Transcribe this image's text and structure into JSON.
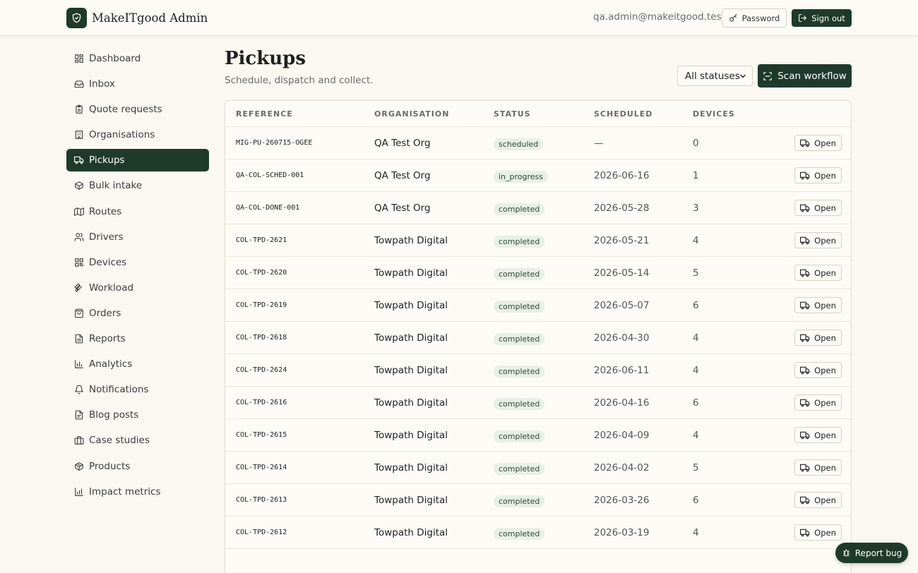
{
  "header": {
    "brand": "MakeITgood Admin",
    "user_email": "qa.admin@makeitgood.test",
    "password_label": "Password",
    "signout_label": "Sign out"
  },
  "sidebar": {
    "items": [
      {
        "label": "Dashboard",
        "icon": "dashboard-icon"
      },
      {
        "label": "Inbox",
        "icon": "inbox-icon"
      },
      {
        "label": "Quote requests",
        "icon": "clipboard-icon"
      },
      {
        "label": "Organisations",
        "icon": "building-icon"
      },
      {
        "label": "Pickups",
        "icon": "truck-icon",
        "active": true
      },
      {
        "label": "Bulk intake",
        "icon": "package-icon"
      },
      {
        "label": "Routes",
        "icon": "map-icon"
      },
      {
        "label": "Drivers",
        "icon": "users-icon"
      },
      {
        "label": "Devices",
        "icon": "qr-icon"
      },
      {
        "label": "Workload",
        "icon": "wrench-icon"
      },
      {
        "label": "Orders",
        "icon": "shopping-bag-icon"
      },
      {
        "label": "Reports",
        "icon": "file-icon"
      },
      {
        "label": "Analytics",
        "icon": "bar-chart-icon"
      },
      {
        "label": "Notifications",
        "icon": "bell-icon"
      },
      {
        "label": "Blog posts",
        "icon": "document-icon"
      },
      {
        "label": "Case studies",
        "icon": "briefcase-icon"
      },
      {
        "label": "Products",
        "icon": "box-icon"
      },
      {
        "label": "Impact metrics",
        "icon": "chart-icon"
      }
    ]
  },
  "main": {
    "title": "Pickups",
    "subtitle": "Schedule, dispatch and collect.",
    "status_filter": "All statuses",
    "scan_label": "Scan workflow",
    "columns": [
      "REFERENCE",
      "ORGANISATION",
      "STATUS",
      "SCHEDULED",
      "DEVICES"
    ],
    "open_label": "Open",
    "rows": [
      {
        "ref": "MIG-PU-260715-OGEE",
        "org": "QA Test Org",
        "status": "scheduled",
        "scheduled": "—",
        "devices": "0"
      },
      {
        "ref": "QA-COL-SCHED-001",
        "org": "QA Test Org",
        "status": "in_progress",
        "scheduled": "2026-06-16",
        "devices": "1"
      },
      {
        "ref": "QA-COL-DONE-001",
        "org": "QA Test Org",
        "status": "completed",
        "scheduled": "2026-05-28",
        "devices": "3"
      },
      {
        "ref": "COL-TPD-2621",
        "org": "Towpath Digital",
        "status": "completed",
        "scheduled": "2026-05-21",
        "devices": "4"
      },
      {
        "ref": "COL-TPD-2620",
        "org": "Towpath Digital",
        "status": "completed",
        "scheduled": "2026-05-14",
        "devices": "5"
      },
      {
        "ref": "COL-TPD-2619",
        "org": "Towpath Digital",
        "status": "completed",
        "scheduled": "2026-05-07",
        "devices": "6"
      },
      {
        "ref": "COL-TPD-2618",
        "org": "Towpath Digital",
        "status": "completed",
        "scheduled": "2026-04-30",
        "devices": "4"
      },
      {
        "ref": "COL-TPD-2624",
        "org": "Towpath Digital",
        "status": "completed",
        "scheduled": "2026-06-11",
        "devices": "4"
      },
      {
        "ref": "COL-TPD-2616",
        "org": "Towpath Digital",
        "status": "completed",
        "scheduled": "2026-04-16",
        "devices": "6"
      },
      {
        "ref": "COL-TPD-2615",
        "org": "Towpath Digital",
        "status": "completed",
        "scheduled": "2026-04-09",
        "devices": "4"
      },
      {
        "ref": "COL-TPD-2614",
        "org": "Towpath Digital",
        "status": "completed",
        "scheduled": "2026-04-02",
        "devices": "5"
      },
      {
        "ref": "COL-TPD-2613",
        "org": "Towpath Digital",
        "status": "completed",
        "scheduled": "2026-03-26",
        "devices": "6"
      },
      {
        "ref": "COL-TPD-2612",
        "org": "Towpath Digital",
        "status": "completed",
        "scheduled": "2026-03-19",
        "devices": "4"
      }
    ]
  },
  "report_bug_label": "Report bug",
  "colors": {
    "accent": "#1f3a2b",
    "background": "#fbf8f1",
    "badge": "#e8efe6"
  }
}
